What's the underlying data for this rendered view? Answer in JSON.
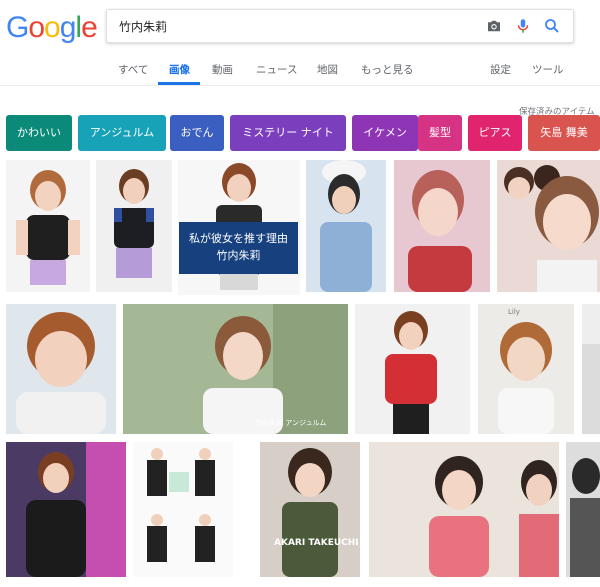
{
  "logo": [
    "G",
    "o",
    "o",
    "g",
    "l",
    "e"
  ],
  "logo_colors": [
    "#4285f4",
    "#ea4335",
    "#fbbc05",
    "#4285f4",
    "#34a853",
    "#ea4335"
  ],
  "search": {
    "query": "竹内朱莉"
  },
  "tabs": [
    {
      "label": "すべて",
      "active": false
    },
    {
      "label": "画像",
      "active": true
    },
    {
      "label": "動画",
      "active": false
    },
    {
      "label": "ニュース",
      "active": false
    },
    {
      "label": "地図",
      "active": false
    },
    {
      "label": "もっと見る",
      "active": false
    }
  ],
  "settings": {
    "label": "設定"
  },
  "tools": {
    "label": "ツール"
  },
  "saved_label": "保存済みのアイテム",
  "chips": [
    {
      "label": "かわいい",
      "color": "#0b8a7a"
    },
    {
      "label": "アンジュルム",
      "color": "#17a2b8"
    },
    {
      "label": "おでん",
      "color": "#3b5fc0"
    },
    {
      "label": "ミステリー ナイト",
      "color": "#7b3fbe"
    },
    {
      "label": "イケメン",
      "color": "#8e35b6"
    },
    {
      "label": "髪型",
      "color": "#d63384"
    },
    {
      "label": "ピアス",
      "color": "#e0246e"
    },
    {
      "label": "矢島 舞美",
      "color": "#d9534f"
    }
  ],
  "thumb_overlay": {
    "line1": "私が彼女を推す理由",
    "line2": "竹内朱莉"
  },
  "thumb_captions": {
    "angerme": "竹内朱莉 アンジュルム",
    "akari": "AKARI TAKEUCHI",
    "lilly": "Lily"
  }
}
